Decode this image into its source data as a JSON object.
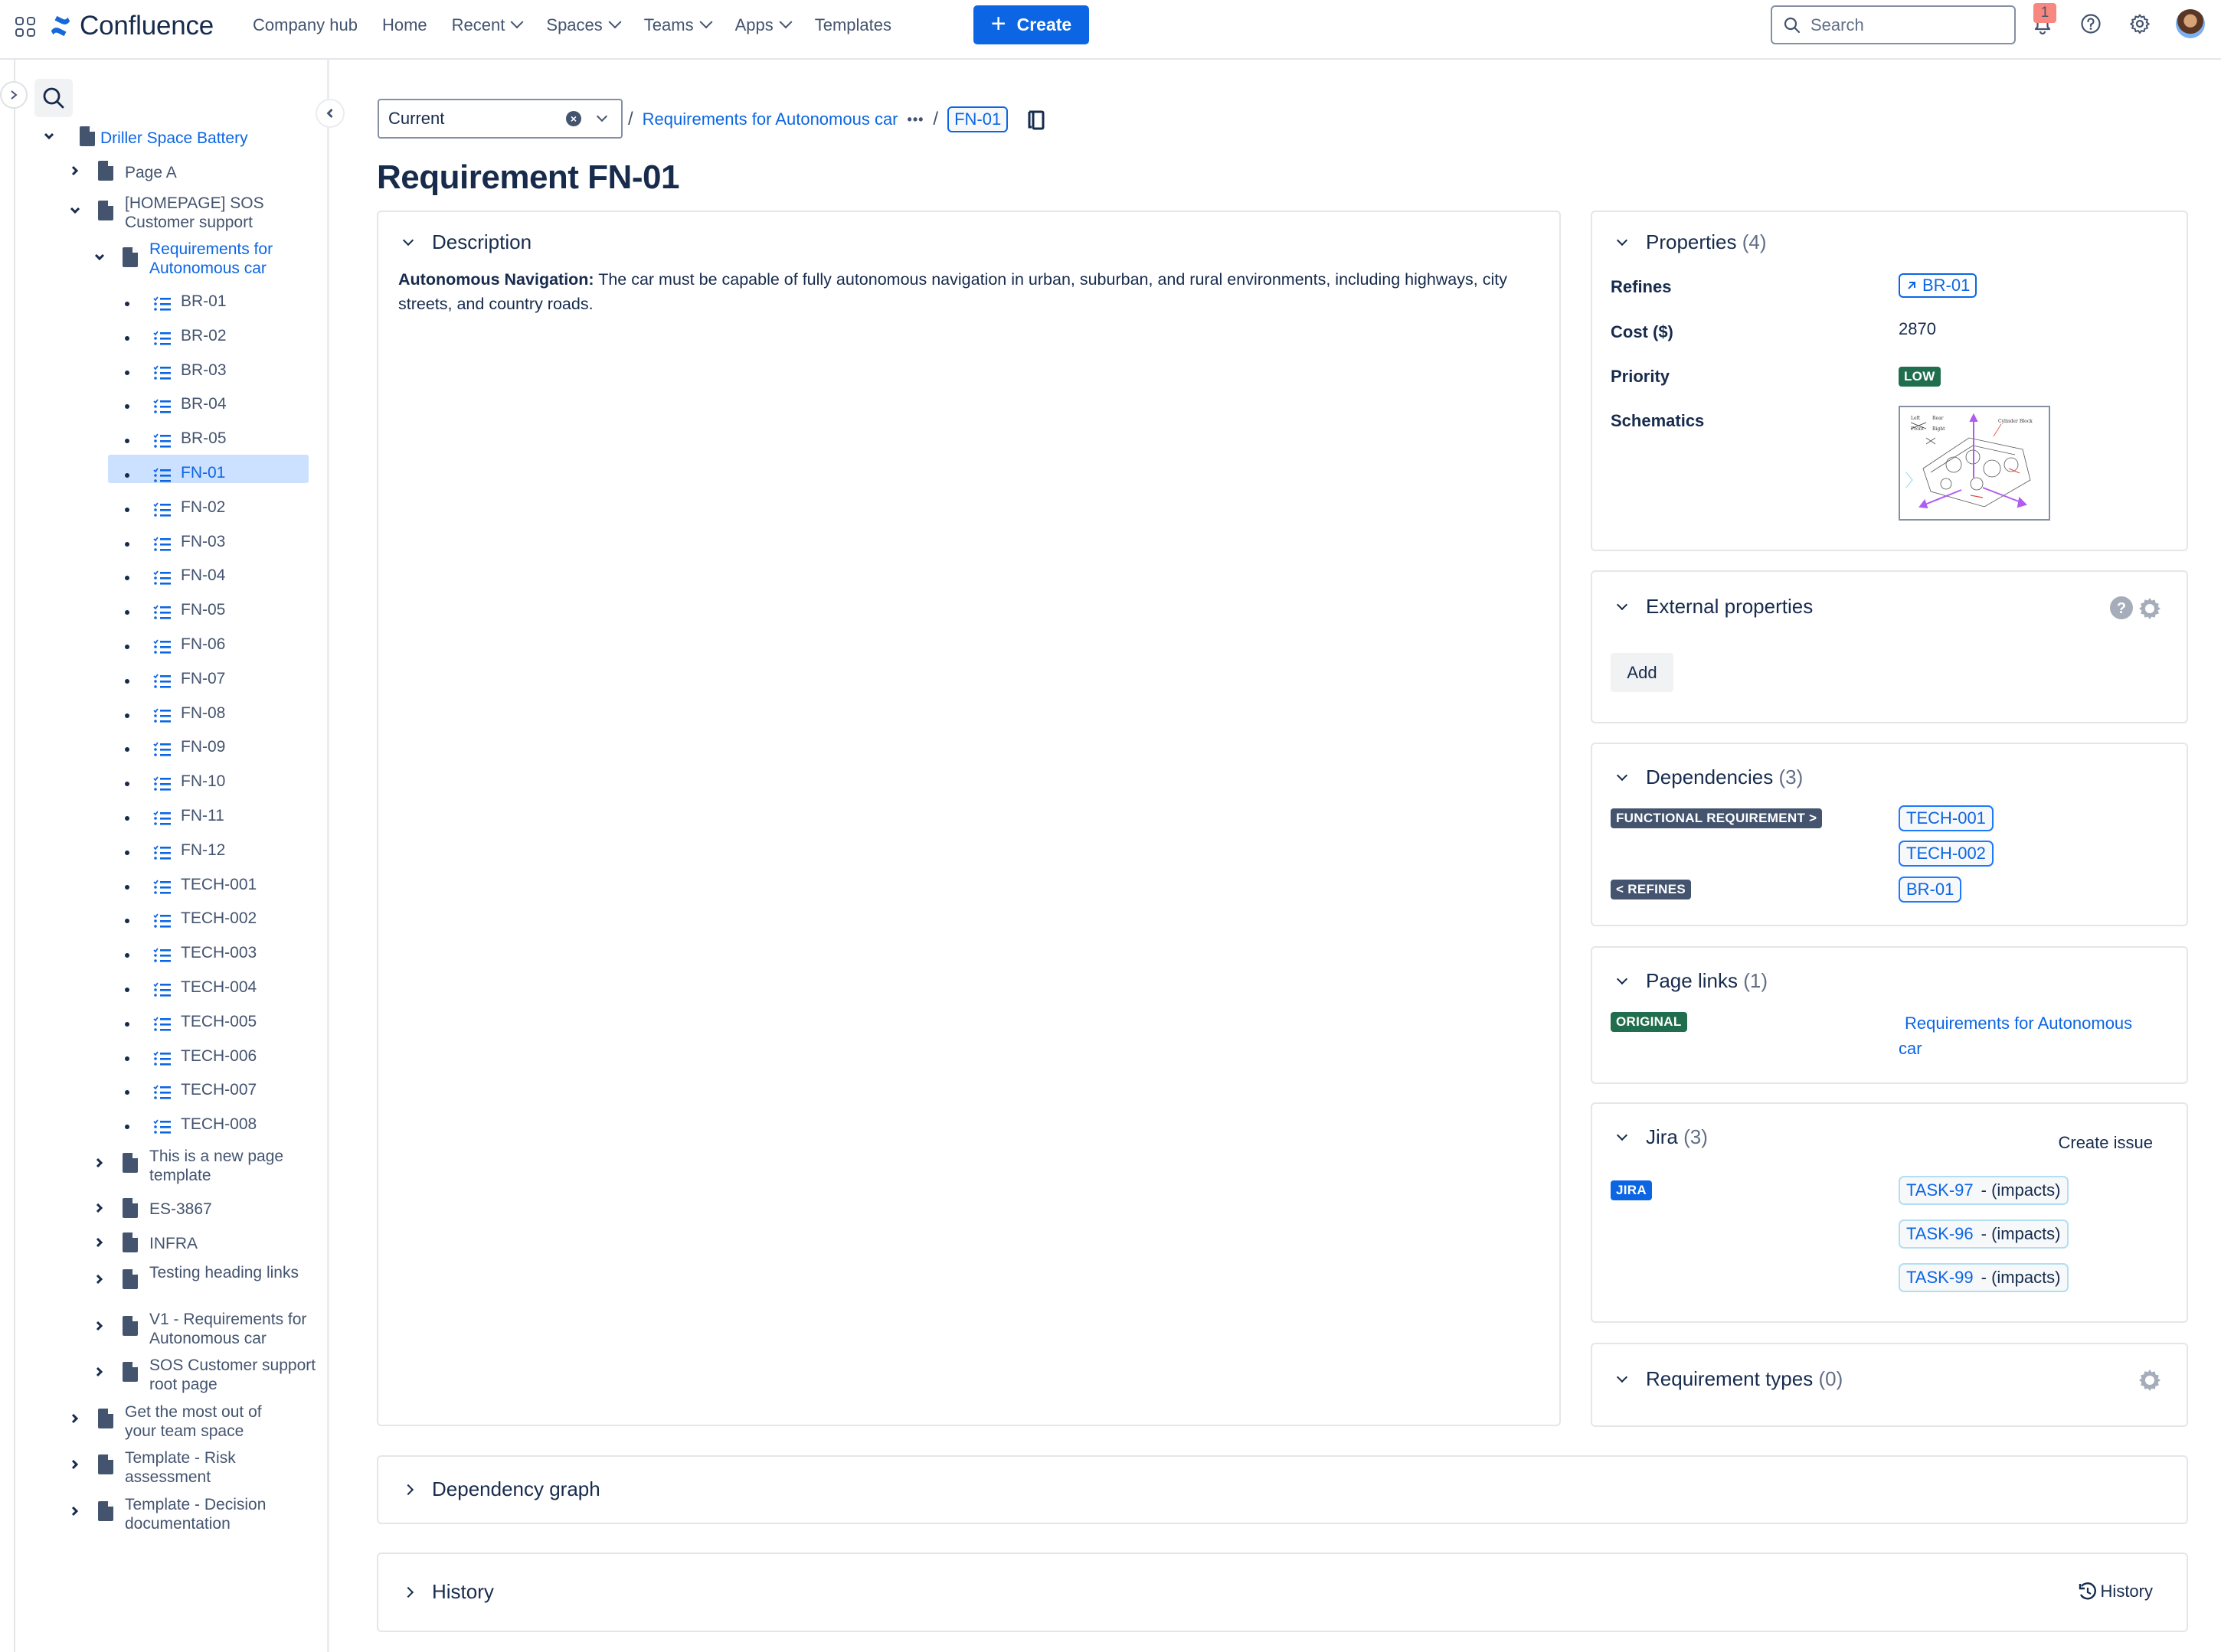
{
  "topnav": {
    "app_name": "Confluence",
    "items": [
      {
        "label": "Company hub",
        "dropdown": false
      },
      {
        "label": "Home",
        "dropdown": false
      },
      {
        "label": "Recent",
        "dropdown": true
      },
      {
        "label": "Spaces",
        "dropdown": true
      },
      {
        "label": "Teams",
        "dropdown": true
      },
      {
        "label": "Apps",
        "dropdown": true
      },
      {
        "label": "Templates",
        "dropdown": false
      }
    ],
    "create_label": "Create",
    "search_placeholder": "Search",
    "notification_count": "1",
    "brand_color": "#0c66e4"
  },
  "sidebar": {
    "root": "Driller Space Battery",
    "page_a": "Page A",
    "homepage": "[HOMEPAGE] SOS Customer support",
    "req_page": "Requirements for Autonomous car",
    "requirements": [
      "BR-01",
      "BR-02",
      "BR-03",
      "BR-04",
      "BR-05",
      "FN-01",
      "FN-02",
      "FN-03",
      "FN-04",
      "FN-05",
      "FN-06",
      "FN-07",
      "FN-08",
      "FN-09",
      "FN-10",
      "FN-11",
      "FN-12",
      "TECH-001",
      "TECH-002",
      "TECH-003",
      "TECH-004",
      "TECH-005",
      "TECH-006",
      "TECH-007",
      "TECH-008"
    ],
    "selected": "FN-01",
    "sub_pages": [
      "This is a new page template",
      "ES-3867",
      "INFRA",
      "Testing heading links",
      "V1 - Requirements for Autonomous car",
      "SOS Customer support root page"
    ],
    "top_pages": [
      "Get the most out of your team space",
      "Template - Risk assessment",
      "Template - Decision documentation"
    ]
  },
  "main": {
    "version_select": "Current",
    "breadcrumb_link": "Requirements for Autonomous car",
    "breadcrumb_more": "•••",
    "breadcrumb_current": "FN-01",
    "title": "Requirement FN-01",
    "description": {
      "heading": "Description",
      "bold_lead": "Autonomous Navigation:",
      "text": " The car must be capable of fully autonomous navigation in urban, suburban, and rural environments, including highways, city streets, and country roads."
    },
    "dependency_graph": "Dependency graph",
    "history": {
      "heading": "History",
      "button": "History"
    }
  },
  "panels": {
    "properties": {
      "heading": "Properties",
      "count": "(4)",
      "rows": [
        {
          "label": "Refines",
          "value": "BR-01"
        },
        {
          "label": "Cost ($)",
          "value": "2870"
        },
        {
          "label": "Priority",
          "value": "LOW"
        },
        {
          "label": "Schematics",
          "value": "Cylinder block schematic diagram"
        }
      ],
      "schematic_labels": [
        "Left",
        "Rear",
        "Front",
        "Right",
        "Cylinder Block",
        "x",
        "y",
        "z"
      ]
    },
    "external": {
      "heading": "External properties",
      "add_label": "Add"
    },
    "dependencies": {
      "heading": "Dependencies",
      "count": "(3)",
      "groups": [
        {
          "type": "FUNCTIONAL REQUIREMENT >",
          "items": [
            "TECH-001",
            "TECH-002"
          ]
        },
        {
          "type": "< REFINES",
          "items": [
            "BR-01"
          ]
        }
      ]
    },
    "page_links": {
      "heading": "Page links",
      "count": "(1)",
      "type": "ORIGINAL",
      "link": "Requirements for Autonomous car"
    },
    "jira": {
      "heading": "Jira",
      "count": "(3)",
      "create_label": "Create issue",
      "type": "JIRA",
      "issues": [
        {
          "key": "TASK-97",
          "relation": "- (impacts)"
        },
        {
          "key": "TASK-96",
          "relation": "- (impacts)"
        },
        {
          "key": "TASK-99",
          "relation": "- (impacts)"
        }
      ]
    },
    "req_types": {
      "heading": "Requirement types",
      "count": "(0)"
    }
  }
}
